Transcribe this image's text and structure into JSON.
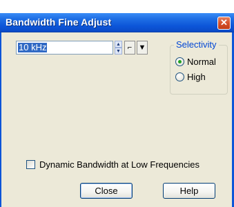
{
  "window": {
    "title": "Bandwidth Fine Adjust"
  },
  "bandwidth": {
    "value": "10 kHz"
  },
  "selectivity": {
    "label": "Selectivity",
    "options": [
      {
        "label": "Normal",
        "selected": true
      },
      {
        "label": "High",
        "selected": false
      }
    ]
  },
  "dynamic_bandwidth": {
    "label": "Dynamic Bandwidth at Low Frequencies",
    "checked": false
  },
  "buttons": {
    "close": "Close",
    "help": "Help"
  },
  "colors": {
    "titlebar": "#0c55d8",
    "dialog_bg": "#ece9d8",
    "selection": "#316ac5",
    "group_label": "#0046d5"
  }
}
